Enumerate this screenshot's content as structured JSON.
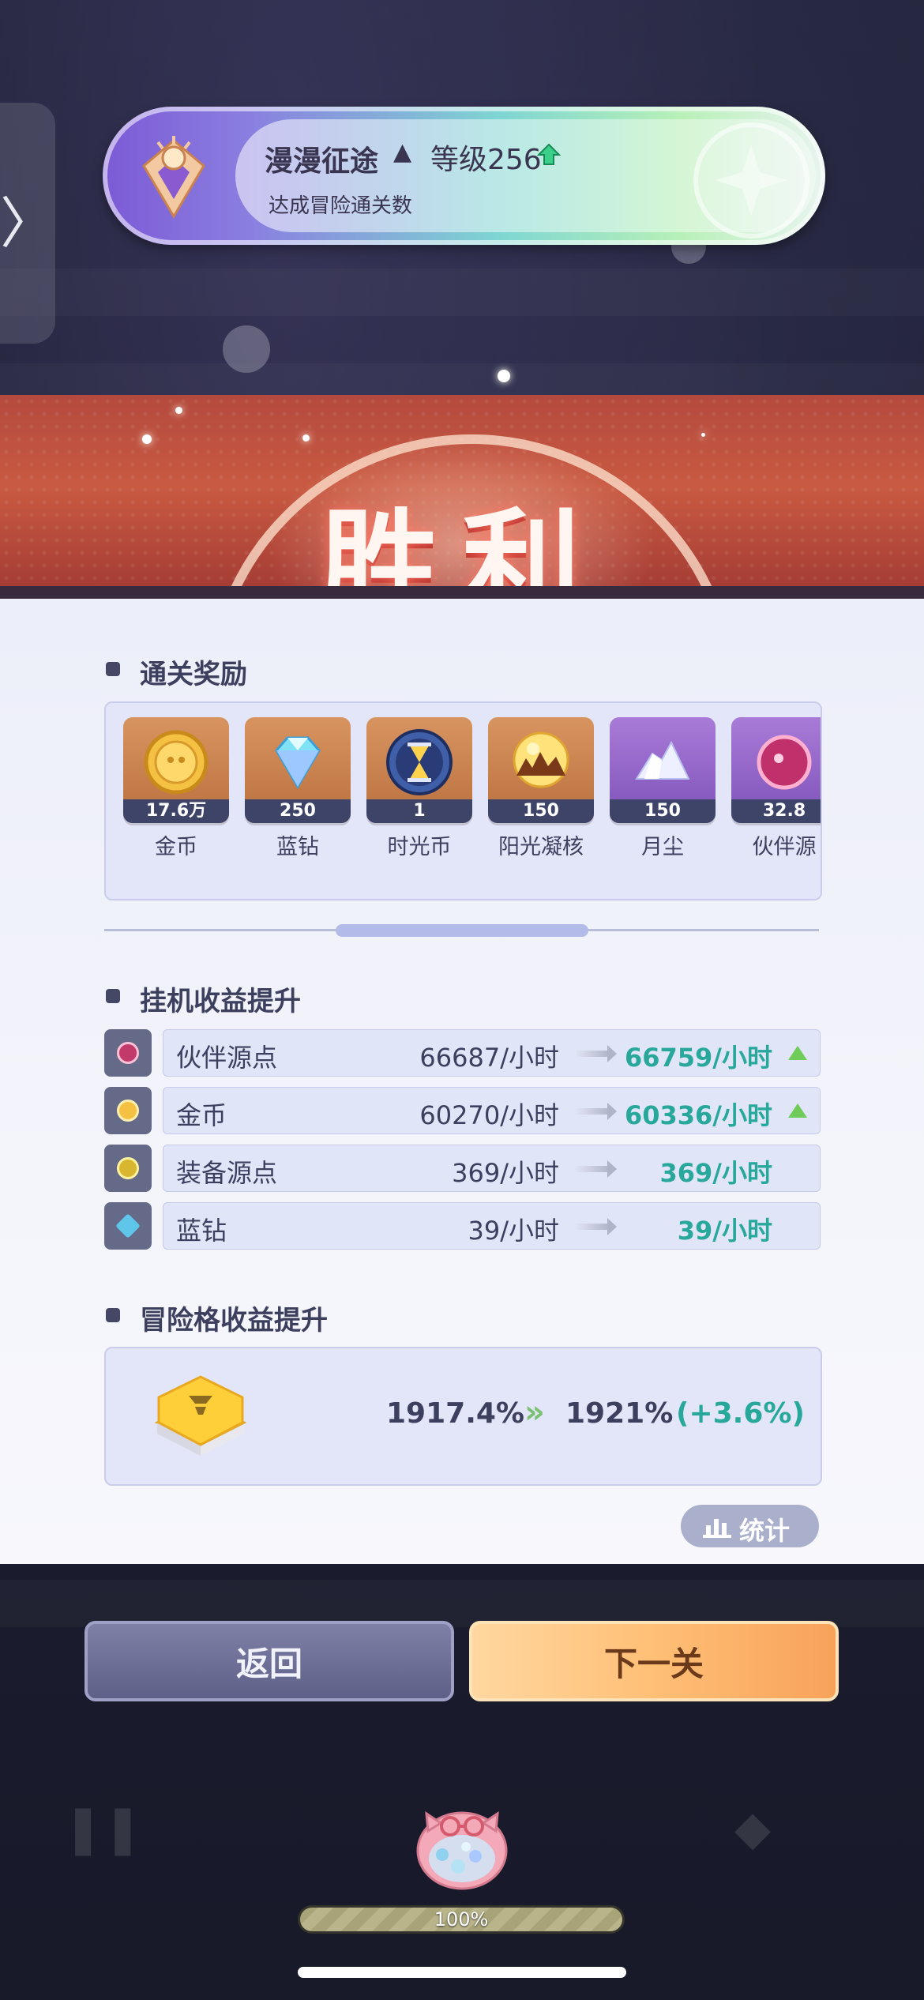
{
  "achievement": {
    "title": "漫漫征途",
    "level": "等级256",
    "description": "达成冒险通关数"
  },
  "victory": {
    "title": "胜利"
  },
  "rewards_section": {
    "title": "通关奖励",
    "items": [
      {
        "name": "金币",
        "count": "17.6万",
        "icon": "gold-coin-icon"
      },
      {
        "name": "蓝钻",
        "count": "250",
        "icon": "blue-diamond-icon"
      },
      {
        "name": "时光币",
        "count": "1",
        "icon": "time-coin-icon"
      },
      {
        "name": "阳光凝核",
        "count": "150",
        "icon": "sunlight-core-icon"
      },
      {
        "name": "月尘",
        "count": "150",
        "icon": "moon-dust-icon"
      },
      {
        "name": "伙伴源",
        "count": "32.8",
        "icon": "partner-source-icon"
      }
    ]
  },
  "idle_section": {
    "title": "挂机收益提升",
    "rows": [
      {
        "name": "伙伴源点",
        "old": "66687/小时",
        "new": "66759/小时",
        "increased": true,
        "color": "#c23a6a"
      },
      {
        "name": "金币",
        "old": "60270/小时",
        "new": "60336/小时",
        "increased": true,
        "color": "#e3b23c"
      },
      {
        "name": "装备源点",
        "old": "369/小时",
        "new": "369/小时",
        "increased": false,
        "color": "#d9b630"
      },
      {
        "name": "蓝钻",
        "old": "39/小时",
        "new": "39/小时",
        "increased": false,
        "color": "#5fc6ea"
      }
    ]
  },
  "grid_section": {
    "title": "冒险格收益提升",
    "old": "1917.4%",
    "new": "1921%",
    "delta": "(+3.6%)"
  },
  "stats_button": {
    "label": "统计"
  },
  "buttons": {
    "back": "返回",
    "next": "下一关"
  },
  "progress": {
    "value": 1.0,
    "label": "100%"
  },
  "colors": {
    "accent_teal": "#27a89a",
    "up_green": "#6fcc5a",
    "victory_red": "#c24a3e"
  }
}
